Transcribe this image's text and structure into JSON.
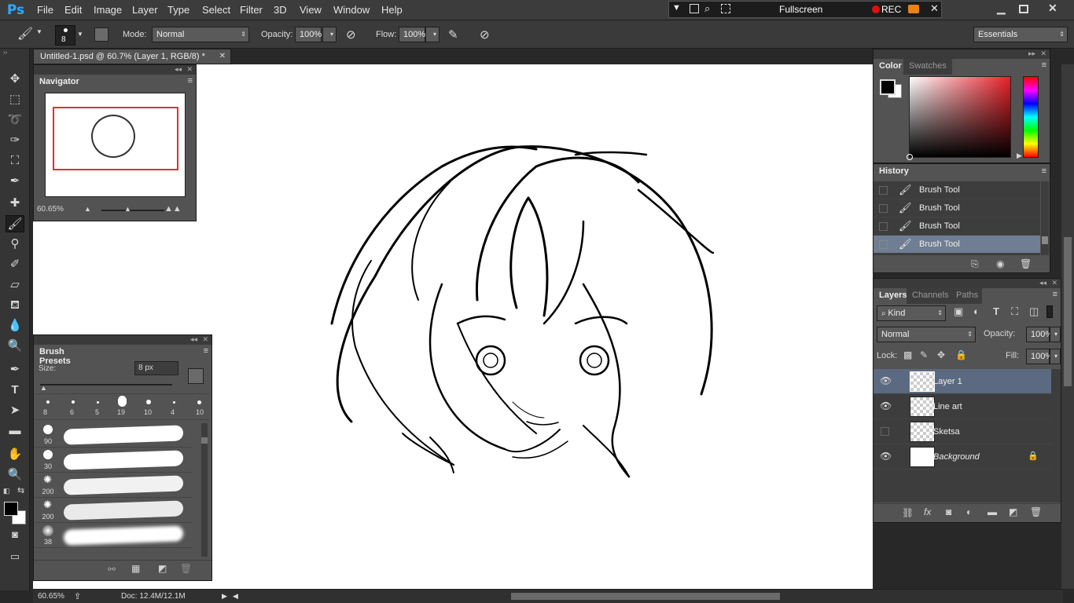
{
  "app": {
    "logo": "Ps"
  },
  "menu": [
    "File",
    "Edit",
    "Image",
    "Layer",
    "Type",
    "Select",
    "Filter",
    "3D",
    "View",
    "Window",
    "Help"
  ],
  "recorder": {
    "mode": "Fullscreen",
    "rec": "REC"
  },
  "options": {
    "brush_size": "8",
    "mode_label": "Mode:",
    "mode_value": "Normal",
    "opacity_label": "Opacity:",
    "opacity_value": "100%",
    "flow_label": "Flow:",
    "flow_value": "100%",
    "workspace": "Essentials"
  },
  "document": {
    "tab_title": "Untitled-1.psd @ 60.7% (Layer 1, RGB/8) *"
  },
  "navigator": {
    "title": "Navigator",
    "zoom": "60.65%"
  },
  "brush_presets": {
    "title": "Brush Presets",
    "size_label": "Size:",
    "size_value": "8 px",
    "tips": [
      "8",
      "6",
      "5",
      "19",
      "10",
      "4",
      "10"
    ],
    "list_sizes": [
      "90",
      "30",
      "200",
      "200",
      "38"
    ]
  },
  "color_panel": {
    "tabs": [
      "Color",
      "Swatches"
    ],
    "hue_color": "#e8202a"
  },
  "history": {
    "title": "History",
    "items": [
      "Brush Tool",
      "Brush Tool",
      "Brush Tool",
      "Brush Tool"
    ]
  },
  "layers": {
    "tabs": [
      "Layers",
      "Channels",
      "Paths"
    ],
    "filter": "Kind",
    "blend_mode": "Normal",
    "opacity_label": "Opacity:",
    "opacity_value": "100%",
    "lock_label": "Lock:",
    "fill_label": "Fill:",
    "fill_value": "100%",
    "items": [
      {
        "name": "Layer 1",
        "visible": true,
        "selected": true
      },
      {
        "name": "Line art",
        "visible": true,
        "selected": false
      },
      {
        "name": "Sketsa",
        "visible": false,
        "selected": false
      },
      {
        "name": "Background",
        "visible": true,
        "selected": false,
        "locked": true
      }
    ]
  },
  "status": {
    "zoom": "60.65%",
    "doc": "Doc: 12.4M/12.1M"
  }
}
